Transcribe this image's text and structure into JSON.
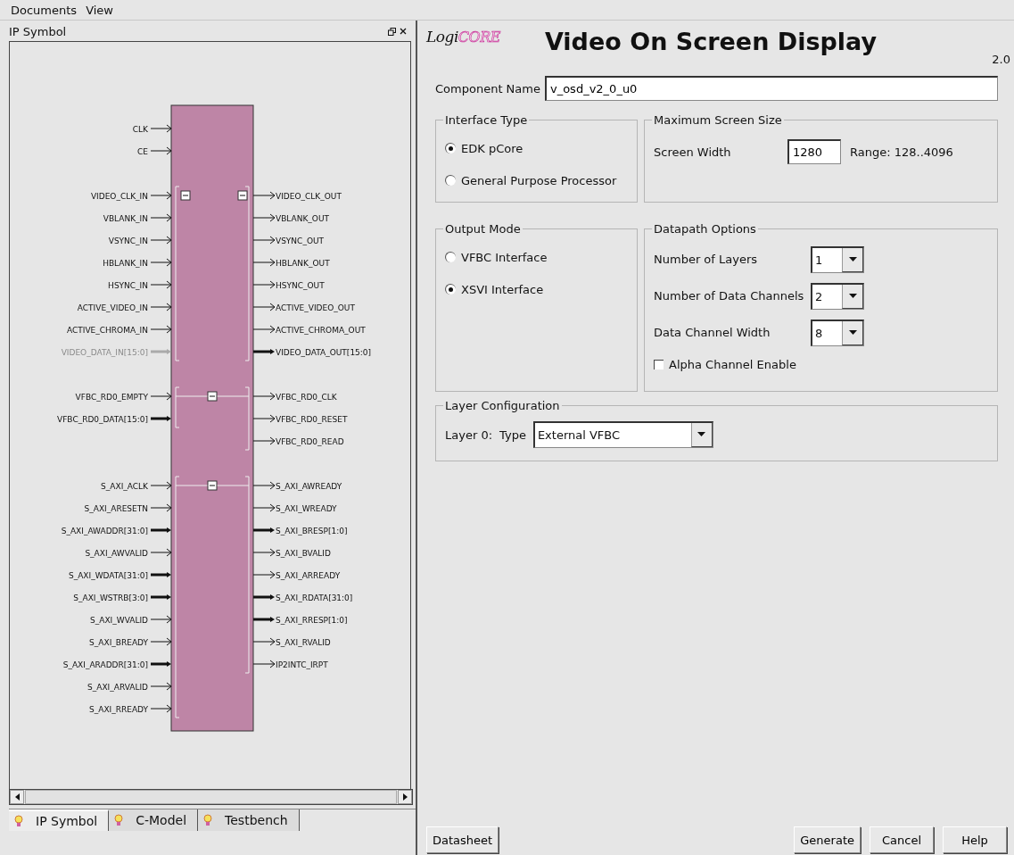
{
  "menu": [
    {
      "label": "Documents"
    },
    {
      "label": "View"
    }
  ],
  "panel": {
    "title": "IP Symbol"
  },
  "symbol": {
    "groups": [
      {
        "kind": "plain",
        "left": [
          {
            "name": "CLK",
            "kind": "signal"
          },
          {
            "name": "CE",
            "kind": "signal"
          }
        ]
      },
      {
        "kind": "split",
        "left": [
          {
            "name": "VIDEO_CLK_IN",
            "kind": "signal"
          },
          {
            "name": "VBLANK_IN",
            "kind": "signal"
          },
          {
            "name": "VSYNC_IN",
            "kind": "signal"
          },
          {
            "name": "HBLANK_IN",
            "kind": "signal"
          },
          {
            "name": "HSYNC_IN",
            "kind": "signal"
          },
          {
            "name": "ACTIVE_VIDEO_IN",
            "kind": "signal"
          },
          {
            "name": "ACTIVE_CHROMA_IN",
            "kind": "signal"
          },
          {
            "name": "VIDEO_DATA_IN[15:0]",
            "kind": "disabled"
          }
        ],
        "right": [
          {
            "name": "VIDEO_CLK_OUT",
            "kind": "signal"
          },
          {
            "name": "VBLANK_OUT",
            "kind": "signal"
          },
          {
            "name": "VSYNC_OUT",
            "kind": "signal"
          },
          {
            "name": "HBLANK_OUT",
            "kind": "signal"
          },
          {
            "name": "HSYNC_OUT",
            "kind": "signal"
          },
          {
            "name": "ACTIVE_VIDEO_OUT",
            "kind": "signal"
          },
          {
            "name": "ACTIVE_CHROMA_OUT",
            "kind": "signal"
          },
          {
            "name": "VIDEO_DATA_OUT[15:0]",
            "kind": "bus"
          }
        ]
      },
      {
        "kind": "joined",
        "left": [
          {
            "name": "VFBC_RD0_EMPTY",
            "kind": "signal"
          },
          {
            "name": "VFBC_RD0_DATA[15:0]",
            "kind": "bus"
          }
        ],
        "right": [
          {
            "name": "VFBC_RD0_CLK",
            "kind": "signal"
          },
          {
            "name": "VFBC_RD0_RESET",
            "kind": "signal"
          },
          {
            "name": "VFBC_RD0_READ",
            "kind": "signal"
          }
        ]
      },
      {
        "kind": "joined",
        "left": [
          {
            "name": "S_AXI_ACLK",
            "kind": "signal"
          },
          {
            "name": "S_AXI_ARESETN",
            "kind": "signal"
          },
          {
            "name": "S_AXI_AWADDR[31:0]",
            "kind": "bus"
          },
          {
            "name": "S_AXI_AWVALID",
            "kind": "signal"
          },
          {
            "name": "S_AXI_WDATA[31:0]",
            "kind": "bus"
          },
          {
            "name": "S_AXI_WSTRB[3:0]",
            "kind": "bus"
          },
          {
            "name": "S_AXI_WVALID",
            "kind": "signal"
          },
          {
            "name": "S_AXI_BREADY",
            "kind": "signal"
          },
          {
            "name": "S_AXI_ARADDR[31:0]",
            "kind": "bus"
          },
          {
            "name": "S_AXI_ARVALID",
            "kind": "signal"
          },
          {
            "name": "S_AXI_RREADY",
            "kind": "signal"
          }
        ],
        "right": [
          {
            "name": "S_AXI_AWREADY",
            "kind": "signal"
          },
          {
            "name": "S_AXI_WREADY",
            "kind": "signal"
          },
          {
            "name": "S_AXI_BRESP[1:0]",
            "kind": "bus"
          },
          {
            "name": "S_AXI_BVALID",
            "kind": "signal"
          },
          {
            "name": "S_AXI_ARREADY",
            "kind": "signal"
          },
          {
            "name": "S_AXI_RDATA[31:0]",
            "kind": "bus"
          },
          {
            "name": "S_AXI_RRESP[1:0]",
            "kind": "bus"
          },
          {
            "name": "S_AXI_RVALID",
            "kind": "signal"
          },
          {
            "name": "IP2INTC_IRPT",
            "kind": "signal"
          }
        ]
      }
    ]
  },
  "bottom_tabs": [
    {
      "label": "IP Symbol",
      "selected": true
    },
    {
      "label": "C-Model",
      "selected": false
    },
    {
      "label": "Testbench",
      "selected": false
    }
  ],
  "header": {
    "logo": [
      "Logi",
      "CORE"
    ],
    "title": "Video On Screen Display",
    "version": "2.0"
  },
  "component_name": {
    "label": "Component Name",
    "value": "v_osd_v2_0_u0"
  },
  "interface_type": {
    "title": "Interface Type",
    "options": [
      {
        "label": "EDK pCore",
        "selected": true
      },
      {
        "label": "General Purpose Processor",
        "selected": false
      }
    ]
  },
  "max_screen_size": {
    "title": "Maximum Screen Size",
    "label": "Screen Width",
    "value": "1280",
    "range": "Range: 128..4096"
  },
  "output_mode": {
    "title": "Output Mode",
    "options": [
      {
        "label": "VFBC Interface",
        "selected": false
      },
      {
        "label": "XSVI Interface",
        "selected": true
      }
    ]
  },
  "datapath_options": {
    "title": "Datapath Options",
    "selects": [
      {
        "label": "Number of Layers",
        "value": "1"
      },
      {
        "label": "Number of Data Channels",
        "value": "2"
      },
      {
        "label": "Data Channel Width",
        "value": "8"
      }
    ],
    "checkbox": {
      "label": "Alpha Channel Enable",
      "checked": false
    }
  },
  "layer_configuration": {
    "title": "Layer Configuration",
    "label": "Layer 0:",
    "type_label": "Type",
    "value": "External VFBC"
  },
  "left_buttons": [
    "Datasheet"
  ],
  "right_buttons": [
    "Generate",
    "Cancel",
    "Help"
  ]
}
